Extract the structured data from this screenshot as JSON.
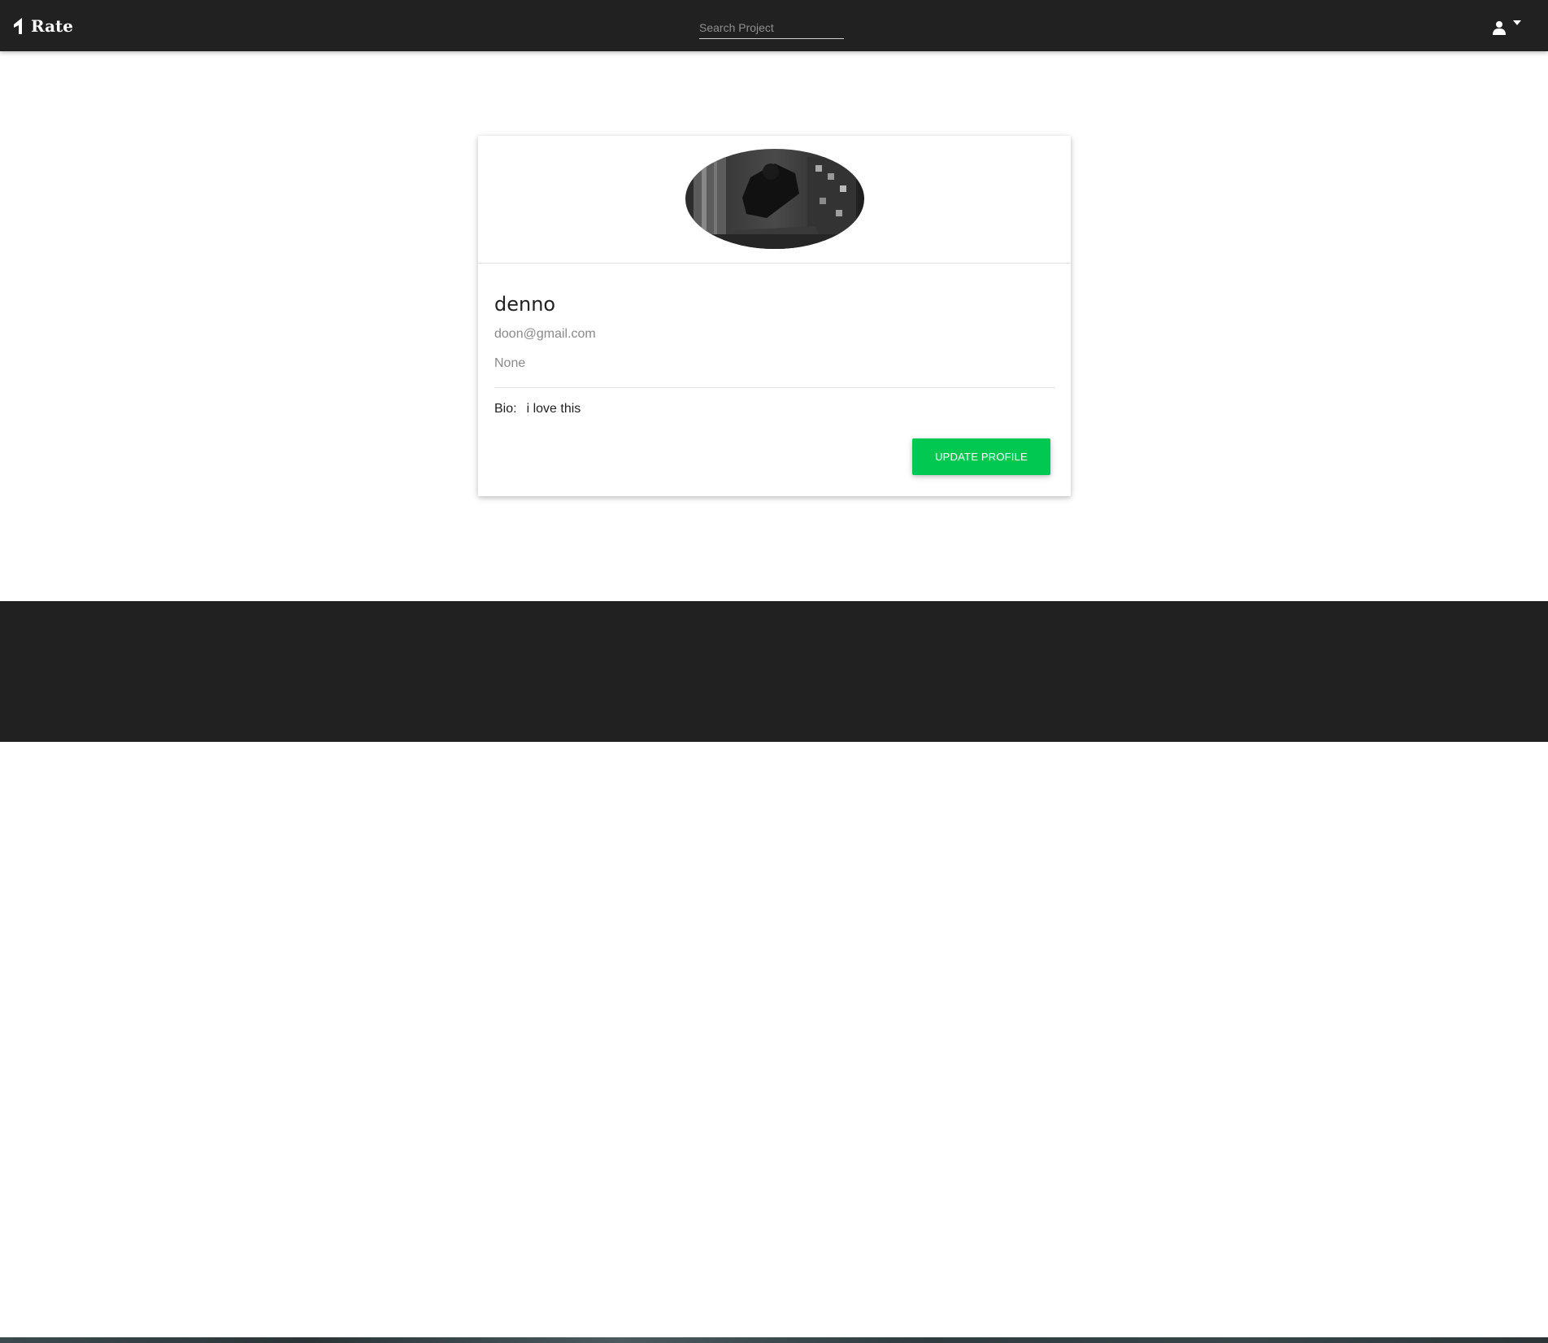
{
  "navbar": {
    "brand": "Rate",
    "search_placeholder": "Search Project",
    "user_icon": "user-icon",
    "caret_icon": "caret-down-icon"
  },
  "profile": {
    "avatar_icon": "profile-photo",
    "username": "denno",
    "email": "doon@gmail.com",
    "extra": "None",
    "bio_label": "Bio:",
    "bio_text": "i love this",
    "update_button": "UPDATE PROFILE"
  },
  "footer": {
    "social_links": [
      "facebook-icon",
      "twitter-icon",
      "google-plus-icon",
      "linkedin-icon",
      "instagram-icon",
      "pinterest-icon"
    ]
  },
  "colors": {
    "navbar_bg": "#212121",
    "button_green": "#00c851",
    "muted_text": "#8a8a8a"
  }
}
